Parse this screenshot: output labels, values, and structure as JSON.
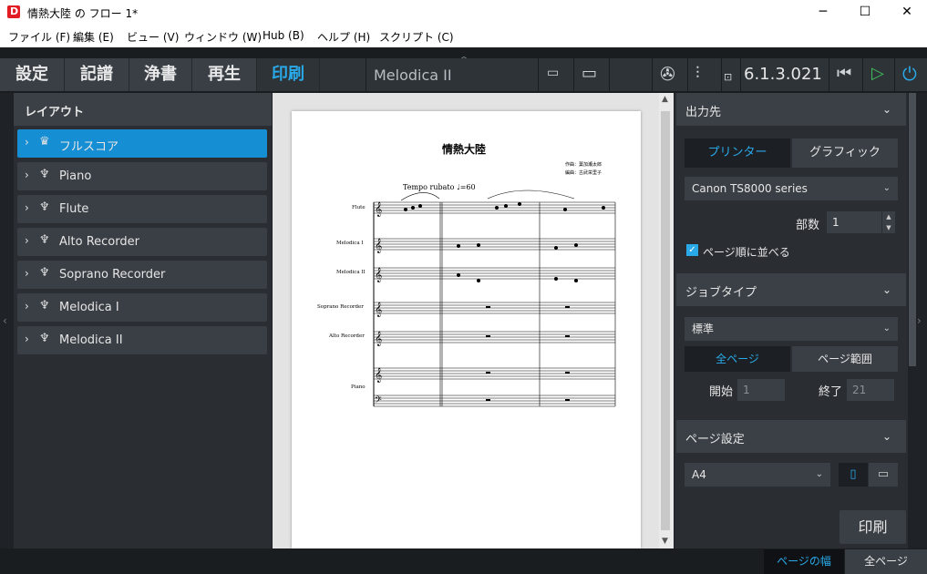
{
  "window": {
    "title": "情熱大陸 の フロー 1*",
    "minimize": "─",
    "maximize": "☐",
    "close": "✕"
  },
  "menu": [
    "ファイル (F)",
    "編集 (E)",
    "ビュー (V)",
    "ウィンドウ (W)",
    "Hub (B)",
    "ヘルプ (H)",
    "スクリプト (C)"
  ],
  "toolbar": {
    "modes": [
      "設定",
      "記譜",
      "浄書",
      "再生",
      "印刷"
    ],
    "active_mode": "印刷",
    "document_title": "Melodica II",
    "version": "6.1.3.021"
  },
  "layouts": {
    "header": "レイアウト",
    "items": [
      {
        "label": "フルスコア",
        "selected": true
      },
      {
        "label": "Piano",
        "selected": false
      },
      {
        "label": "Flute",
        "selected": false
      },
      {
        "label": "Alto Recorder",
        "selected": false
      },
      {
        "label": "Soprano Recorder",
        "selected": false
      },
      {
        "label": "Melodica I",
        "selected": false
      },
      {
        "label": "Melodica II",
        "selected": false
      }
    ]
  },
  "score": {
    "title": "情熱大陸",
    "composer": "作曲：葉加瀬太郎",
    "arranger": "編曲：古武栄里子",
    "tempo": "Tempo rubato ♩=60",
    "staff_labels": [
      "Flute",
      "Melodica I",
      "Melodica II",
      "Soprano Recorder",
      "Alto Recorder",
      "Piano"
    ]
  },
  "output": {
    "header": "出力先",
    "tabs": [
      "プリンター",
      "グラフィック"
    ],
    "active_tab": "プリンター",
    "printer": "Canon TS8000 series",
    "copies_label": "部数",
    "copies": "1",
    "collate_label": "ページ順に並べる",
    "collate_checked": true
  },
  "job": {
    "header": "ジョブタイプ",
    "type": "標準",
    "range_tabs": [
      "全ページ",
      "ページ範囲"
    ],
    "active_range": "全ページ",
    "start_label": "開始",
    "start": "1",
    "end_label": "終了",
    "end": "21"
  },
  "page_setup": {
    "header": "ページ設定",
    "size": "A4"
  },
  "print_button": "印刷",
  "zoom": {
    "page_width": "ページの幅",
    "all_pages": "全ページ"
  },
  "colors": {
    "accent": "#2aa9e8",
    "selected": "#168ed3"
  }
}
